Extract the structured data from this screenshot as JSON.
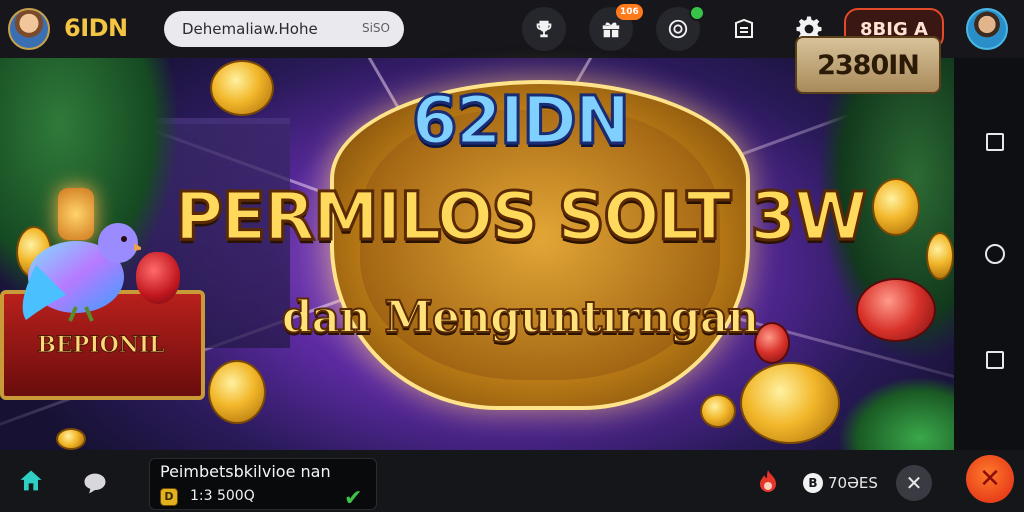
{
  "header": {
    "brand": "6IDN",
    "search_text": "Dehemaliaw.Hohe",
    "search_suffix": "SiSO",
    "notification_badge": "106",
    "balance_button": "8BIG A"
  },
  "banner": {
    "title_brand": "62IDN",
    "title_main": "PERMILOS SOLT 3W",
    "title_sub": "dan Menguntırngan",
    "promo_label": "2380IN",
    "chest_label": "BEPIONIL"
  },
  "bottombar": {
    "notice_title": "Peimbetsbkilvioe nan",
    "notice_coin": "D",
    "notice_amount": "1:3 500Q",
    "count_label": "70ƏES"
  },
  "colors": {
    "brand": "#f4c542",
    "accent_red": "#e24a2a",
    "fab": "#e8401a",
    "success": "#3ec24a"
  },
  "icons": [
    "profile-avatar",
    "trophy-icon",
    "gift-icon",
    "target-icon",
    "inbox-icon",
    "gear-icon",
    "user-avatar",
    "home-icon",
    "chat-icon",
    "fire-icon",
    "coin-icon",
    "close-icon",
    "lifebuoy-icon"
  ]
}
